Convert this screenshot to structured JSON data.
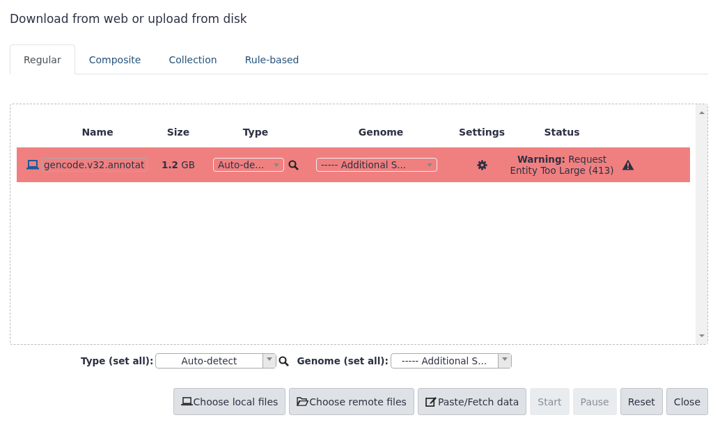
{
  "title": "Download from web or upload from disk",
  "tabs": [
    {
      "label": "Regular",
      "selected": true
    },
    {
      "label": "Composite",
      "selected": false
    },
    {
      "label": "Collection",
      "selected": false
    },
    {
      "label": "Rule-based",
      "selected": false
    }
  ],
  "columns": [
    "Name",
    "Size",
    "Type",
    "Genome",
    "Settings",
    "Status"
  ],
  "rows": [
    {
      "kind": "error",
      "name": "gencode.v32.annotat",
      "size_value": "1.2",
      "size_unit": "GB",
      "type": "Auto-de...",
      "genome": "----- Additional S...",
      "status_label": "Warning:",
      "status_text": "Request Entity Too Large (413)"
    }
  ],
  "set_all": {
    "type_label": "Type (set all):",
    "type_value": "Auto-detect",
    "genome_label": "Genome (set all):",
    "genome_value": "----- Additional S..."
  },
  "buttons": [
    {
      "label": "Choose local files",
      "kind": "laptop",
      "disabled": false
    },
    {
      "label": "Choose remote files",
      "kind": "folder",
      "disabled": false
    },
    {
      "label": "Paste/Fetch data",
      "kind": "edit",
      "disabled": false
    },
    {
      "label": "Start",
      "kind": "plain",
      "disabled": true
    },
    {
      "label": "Pause",
      "kind": "plain",
      "disabled": true
    },
    {
      "label": "Reset",
      "kind": "plain",
      "disabled": false
    },
    {
      "label": "Close",
      "kind": "plain",
      "disabled": false
    }
  ]
}
